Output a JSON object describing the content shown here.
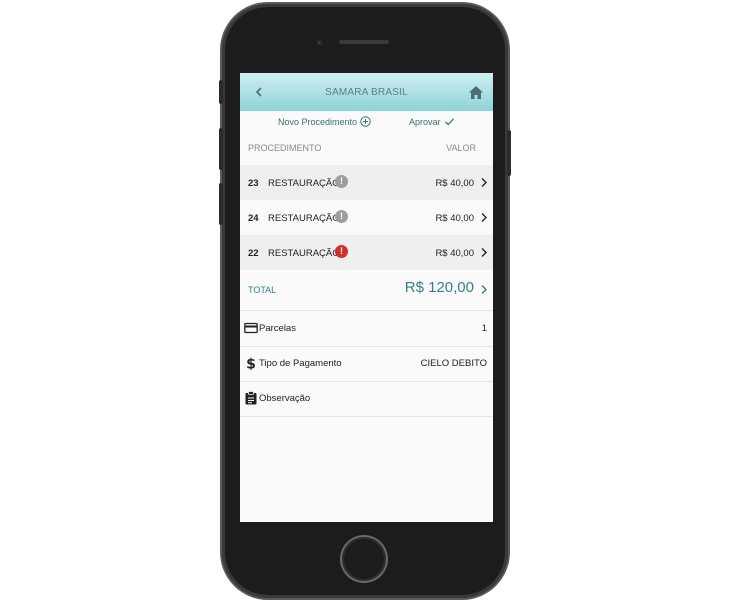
{
  "header": {
    "title": "SAMARA BRASIL"
  },
  "actions": {
    "new_procedure": "Novo Procedimento",
    "approve": "Aprovar"
  },
  "columns": {
    "procedure": "PROCEDIMENTO",
    "value": "VALOR"
  },
  "procedures": [
    {
      "number": "23",
      "name": "RESTAURAÇÃO",
      "alert": "!",
      "alert_color": "#9e9e9e",
      "value": "R$  40,00"
    },
    {
      "number": "24",
      "name": "RESTAURAÇÃO",
      "alert": "!",
      "alert_color": "#9e9e9e",
      "value": "R$  40,00"
    },
    {
      "number": "22",
      "name": "RESTAURAÇÃO",
      "alert": "!",
      "alert_color": "#d32f2f",
      "value": "R$  40,00"
    }
  ],
  "total": {
    "label": "TOTAL",
    "amount": "R$  120,00"
  },
  "details": {
    "installments": {
      "label": "Parcelas",
      "value": "1",
      "icon": "credit-card-icon"
    },
    "payment_type": {
      "label": "Tipo de Pagamento",
      "value": "CIELO DEBITO",
      "icon": "dollar-icon"
    },
    "notes": {
      "label": "Observação",
      "icon": "clipboard-icon"
    }
  },
  "colors": {
    "accent": "#3b7e85",
    "header_top": "#cfeef0",
    "header_bottom": "#8ed3d8"
  }
}
